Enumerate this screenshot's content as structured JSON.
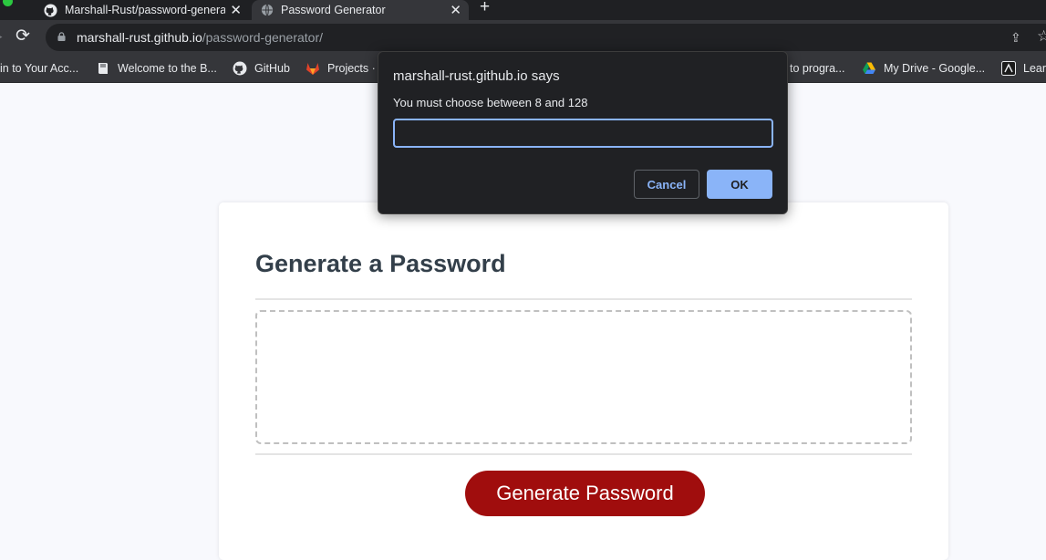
{
  "browser": {
    "tabs": [
      {
        "title": "Marshall-Rust/password-generator",
        "icon": "github-icon",
        "active": false
      },
      {
        "title": "Password Generator",
        "icon": "globe-icon",
        "active": true
      }
    ],
    "new_tab_label": "+",
    "close_glyph": "✕",
    "url_host": "marshall-rust.github.io",
    "url_path": "/password-generator/",
    "bookmarks": [
      {
        "label": "in to Your Acc...",
        "icon": "none"
      },
      {
        "label": "Welcome to the B...",
        "icon": "book-icon"
      },
      {
        "label": "GitHub",
        "icon": "github-icon"
      },
      {
        "label": "Projects ·",
        "icon": "gitlab-icon"
      },
      {
        "label": "to progra...",
        "icon": "none"
      },
      {
        "label": "My Drive - Google...",
        "icon": "google-drive-icon"
      },
      {
        "label": "Lear",
        "icon": "learn-icon"
      }
    ]
  },
  "page": {
    "title": "Generate a Password",
    "password_value": "",
    "generate_label": "Generate Password"
  },
  "dialog": {
    "title": "marshall-rust.github.io says",
    "message": "You must choose between 8 and 128",
    "input_value": "",
    "cancel_label": "Cancel",
    "ok_label": "OK"
  },
  "colors": {
    "accent_button": "#a00d0d",
    "dialog_primary": "#8ab4f8",
    "page_background": "#f8f9fd"
  }
}
